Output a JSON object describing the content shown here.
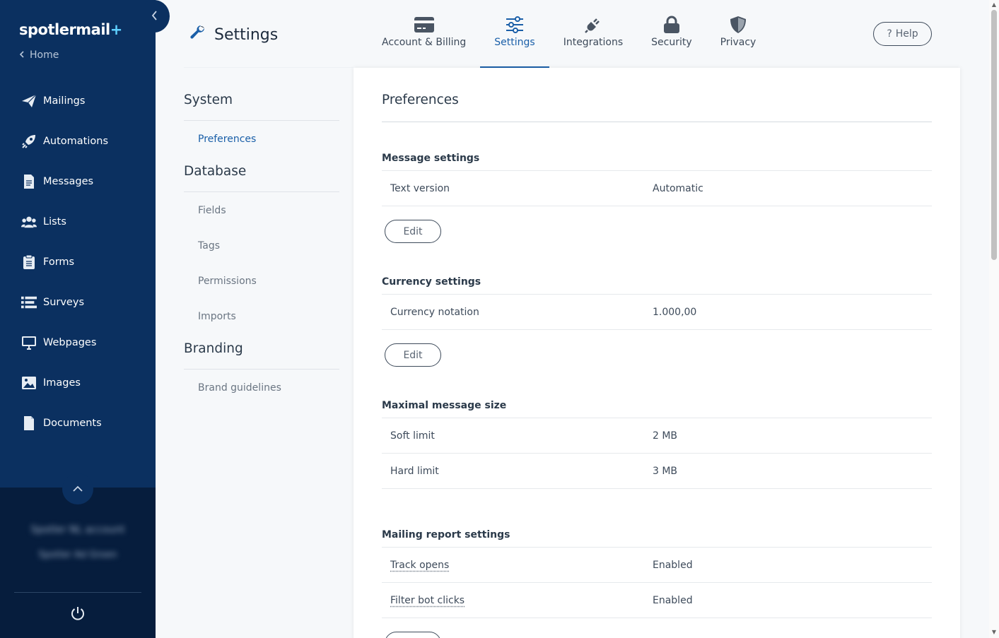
{
  "app": {
    "logo_text": "spotlermail",
    "logo_plus": "+",
    "home_label": "Home"
  },
  "sidebar": {
    "items": [
      {
        "label": "Mailings",
        "icon": "paper-plane-icon"
      },
      {
        "label": "Automations",
        "icon": "rocket-icon"
      },
      {
        "label": "Messages",
        "icon": "document-icon"
      },
      {
        "label": "Lists",
        "icon": "users-icon"
      },
      {
        "label": "Forms",
        "icon": "clipboard-icon"
      },
      {
        "label": "Surveys",
        "icon": "list-icon"
      },
      {
        "label": "Webpages",
        "icon": "monitor-icon"
      },
      {
        "label": "Images",
        "icon": "image-icon"
      },
      {
        "label": "Documents",
        "icon": "file-icon"
      }
    ],
    "account_name": "Spotler NL account",
    "account_sub": "Spotler Ad Groen"
  },
  "header": {
    "title": "Settings",
    "tabs": [
      {
        "label": "Account & Billing",
        "icon": "credit-card-icon",
        "active": false
      },
      {
        "label": "Settings",
        "icon": "sliders-icon",
        "active": true
      },
      {
        "label": "Integrations",
        "icon": "plug-icon",
        "active": false
      },
      {
        "label": "Security",
        "icon": "lock-icon",
        "active": false
      },
      {
        "label": "Privacy",
        "icon": "shield-icon",
        "active": false
      }
    ],
    "help_label": "Help"
  },
  "settings_nav": {
    "groups": [
      {
        "title": "System",
        "items": [
          {
            "label": "Preferences",
            "active": true
          }
        ]
      },
      {
        "title": "Database",
        "items": [
          {
            "label": "Fields"
          },
          {
            "label": "Tags"
          },
          {
            "label": "Permissions"
          },
          {
            "label": "Imports"
          }
        ]
      },
      {
        "title": "Branding",
        "items": [
          {
            "label": "Brand guidelines"
          }
        ]
      }
    ]
  },
  "main": {
    "title": "Preferences",
    "edit_label": "Edit",
    "sections": [
      {
        "title": "Message settings",
        "rows": [
          {
            "label": "Text version",
            "value": "Automatic"
          }
        ]
      },
      {
        "title": "Currency settings",
        "rows": [
          {
            "label": "Currency notation",
            "value": "1.000,00"
          }
        ]
      },
      {
        "title": "Maximal message size",
        "rows": [
          {
            "label": "Soft limit",
            "value": "2 MB"
          },
          {
            "label": "Hard limit",
            "value": "3 MB"
          }
        ]
      },
      {
        "title": "Mailing report settings",
        "rows": [
          {
            "label": "Track opens",
            "value": "Enabled"
          },
          {
            "label": "Filter bot clicks",
            "value": "Enabled"
          }
        ]
      }
    ]
  },
  "colors": {
    "sidebar_bg": "#0b3060",
    "sidebar_bottom_bg": "#061d3d",
    "accent": "#1a5fa8",
    "logo_plus": "#5fd1ff"
  }
}
